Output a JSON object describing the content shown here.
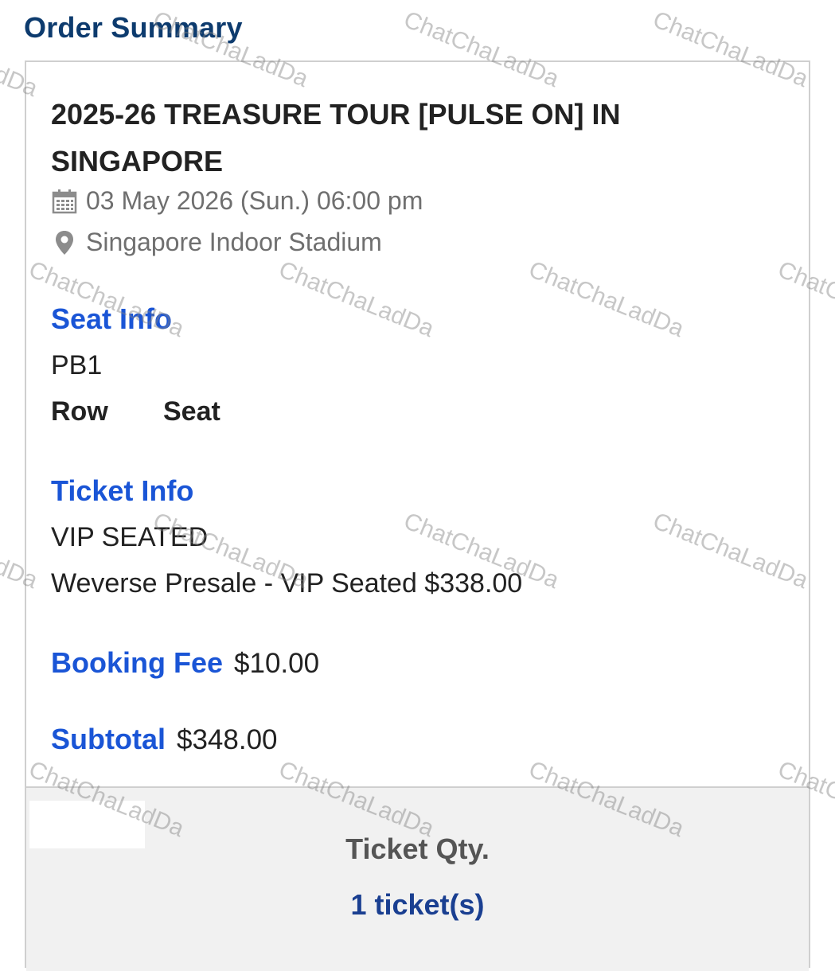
{
  "header": {
    "title": "Order Summary"
  },
  "event": {
    "title": "2025-26 TREASURE TOUR [PULSE ON] IN SINGAPORE",
    "datetime": "03 May 2026 (Sun.) 06:00 pm",
    "venue": "Singapore Indoor Stadium"
  },
  "seat_info": {
    "label": "Seat Info",
    "section": "PB1",
    "row_label": "Row",
    "seat_label": "Seat"
  },
  "ticket_info": {
    "label": "Ticket Info",
    "category": "VIP SEATED",
    "detail": "Weverse Presale - VIP Seated $338.00"
  },
  "booking_fee": {
    "label": "Booking Fee",
    "value": "$10.00"
  },
  "subtotal": {
    "label": "Subtotal",
    "value": "$348.00"
  },
  "qty": {
    "label": "Ticket Qty.",
    "value": "1 ticket(s)"
  },
  "watermark": {
    "text": "ChatChaLadDa"
  },
  "colors": {
    "title": "#0d3b6e",
    "accent": "#1a55d6",
    "qty": "#1a3f91",
    "muted": "#6f6f6f"
  },
  "icons": {
    "date": "calendar-icon",
    "venue": "map-pin-icon"
  }
}
